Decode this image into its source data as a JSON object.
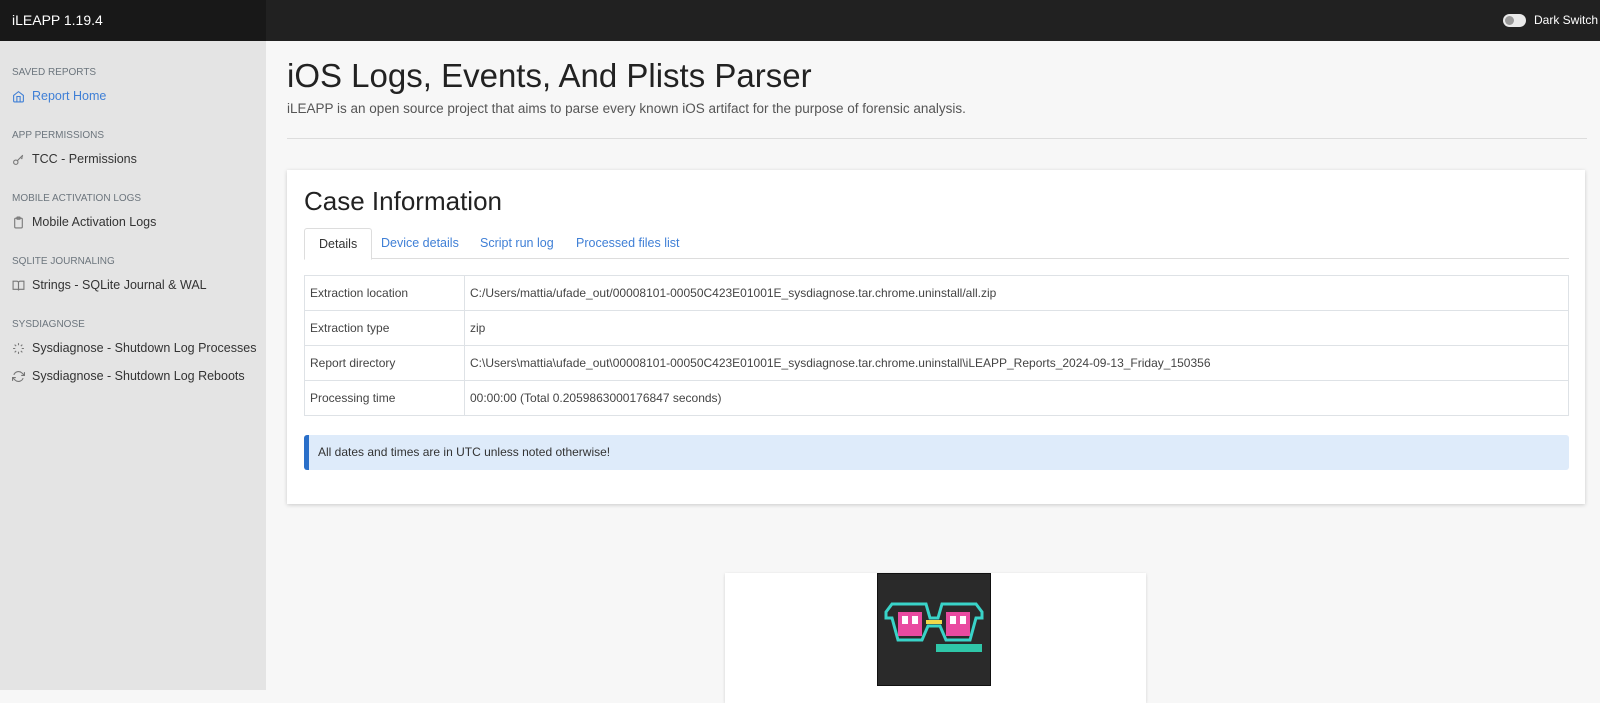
{
  "app": {
    "title": "iLEAPP 1.19.4"
  },
  "topbar": {
    "dark_switch_label": "Dark Switch"
  },
  "sidebar": {
    "sections": [
      {
        "heading": "SAVED REPORTS",
        "items": [
          {
            "label": "Report Home",
            "icon": "home-icon",
            "active": true
          }
        ]
      },
      {
        "heading": "APP PERMISSIONS",
        "items": [
          {
            "label": "TCC - Permissions",
            "icon": "key-icon"
          }
        ]
      },
      {
        "heading": "MOBILE ACTIVATION LOGS",
        "items": [
          {
            "label": "Mobile Activation Logs",
            "icon": "clipboard-icon"
          }
        ]
      },
      {
        "heading": "SQLITE JOURNALING",
        "items": [
          {
            "label": "Strings - SQLite Journal & WAL",
            "icon": "book-open-icon"
          }
        ]
      },
      {
        "heading": "SYSDIAGNOSE",
        "items": [
          {
            "label": "Sysdiagnose - Shutdown Log Processes",
            "icon": "loader-icon"
          },
          {
            "label": "Sysdiagnose - Shutdown Log Reboots",
            "icon": "refresh-icon"
          }
        ]
      }
    ]
  },
  "main": {
    "title": "iOS Logs, Events, And Plists Parser",
    "description": "iLEAPP is an open source project that aims to parse every known iOS artifact for the purpose of forensic analysis."
  },
  "case": {
    "title": "Case Information",
    "tabs": [
      {
        "label": "Details",
        "active": true
      },
      {
        "label": "Device details"
      },
      {
        "label": "Script run log"
      },
      {
        "label": "Processed files list"
      }
    ],
    "rows": [
      {
        "label": "Extraction location",
        "value": "C:/Users/mattia/ufade_out/00008101-00050C423E01001E_sysdiagnose.tar.chrome.uninstall/all.zip"
      },
      {
        "label": "Extraction type",
        "value": "zip"
      },
      {
        "label": "Report directory",
        "value": "C:\\Users\\mattia\\ufade_out\\00008101-00050C423E01001E_sysdiagnose.tar.chrome.uninstall\\iLEAPP_Reports_2024-09-13_Friday_150356"
      },
      {
        "label": "Processing time",
        "value": "00:00:00 (Total 0.2059863000176847 seconds)"
      }
    ],
    "alert": "All dates and times are in UTC unless noted otherwise!"
  },
  "colors": {
    "accent": "#3f7fd6",
    "topbar": "#212121",
    "sidebar": "#e4e4e4",
    "alert_bg": "#deebfa",
    "alert_border": "#2a6fc9"
  }
}
